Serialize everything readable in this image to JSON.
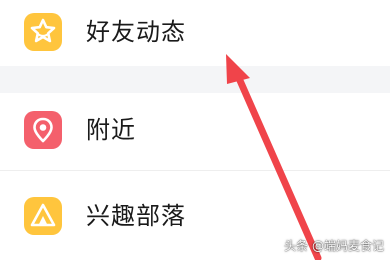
{
  "menu": {
    "items": [
      {
        "label": "好友动态",
        "icon": "star-icon",
        "color": "#FFC53D"
      },
      {
        "label": "附近",
        "icon": "location-pin-icon",
        "color": "#F4606C"
      },
      {
        "label": "兴趣部落",
        "icon": "tent-icon",
        "color": "#FFC53D"
      }
    ]
  },
  "watermark": "头条 @端妈麦食记",
  "annotation": {
    "arrow_color": "#F0444A"
  }
}
